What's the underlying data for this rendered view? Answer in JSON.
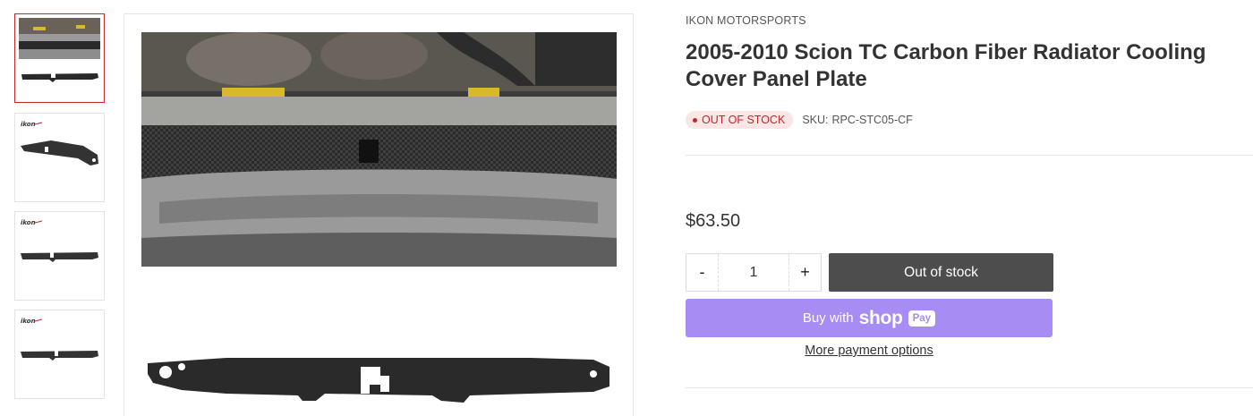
{
  "gallery": {
    "thumbnails": [
      {
        "name": "engine-bay-with-panel",
        "selected": true
      },
      {
        "name": "panel-angled",
        "selected": false,
        "watermark": "ikon"
      },
      {
        "name": "panel-flat",
        "selected": false,
        "watermark": "ikon"
      },
      {
        "name": "panel-flat-alt",
        "selected": false,
        "watermark": "ikon"
      }
    ],
    "main_images": [
      "engine-bay-installed-view",
      "carbon-fiber-panel-front-view"
    ]
  },
  "product": {
    "vendor": "IKON MOTORSPORTS",
    "title": "2005-2010 Scion TC Carbon Fiber Radiator Cooling Cover Panel Plate",
    "stock_status": "OUT OF STOCK",
    "sku_label": "SKU:",
    "sku_value": "RPC-STC05-CF",
    "price": "$63.50",
    "quantity": "1",
    "minus_label": "-",
    "plus_label": "+",
    "add_button_label": "Out of stock",
    "shop_pay": {
      "buy_with": "Buy with",
      "shop": "shop",
      "pay": "Pay"
    },
    "more_payment_label": "More payment options"
  },
  "colors": {
    "accent_red": "#c0282e",
    "badge_bg": "#fbe6e6",
    "disabled_button": "#4d4d4d",
    "shop_pay_purple": "#a78cf3"
  }
}
